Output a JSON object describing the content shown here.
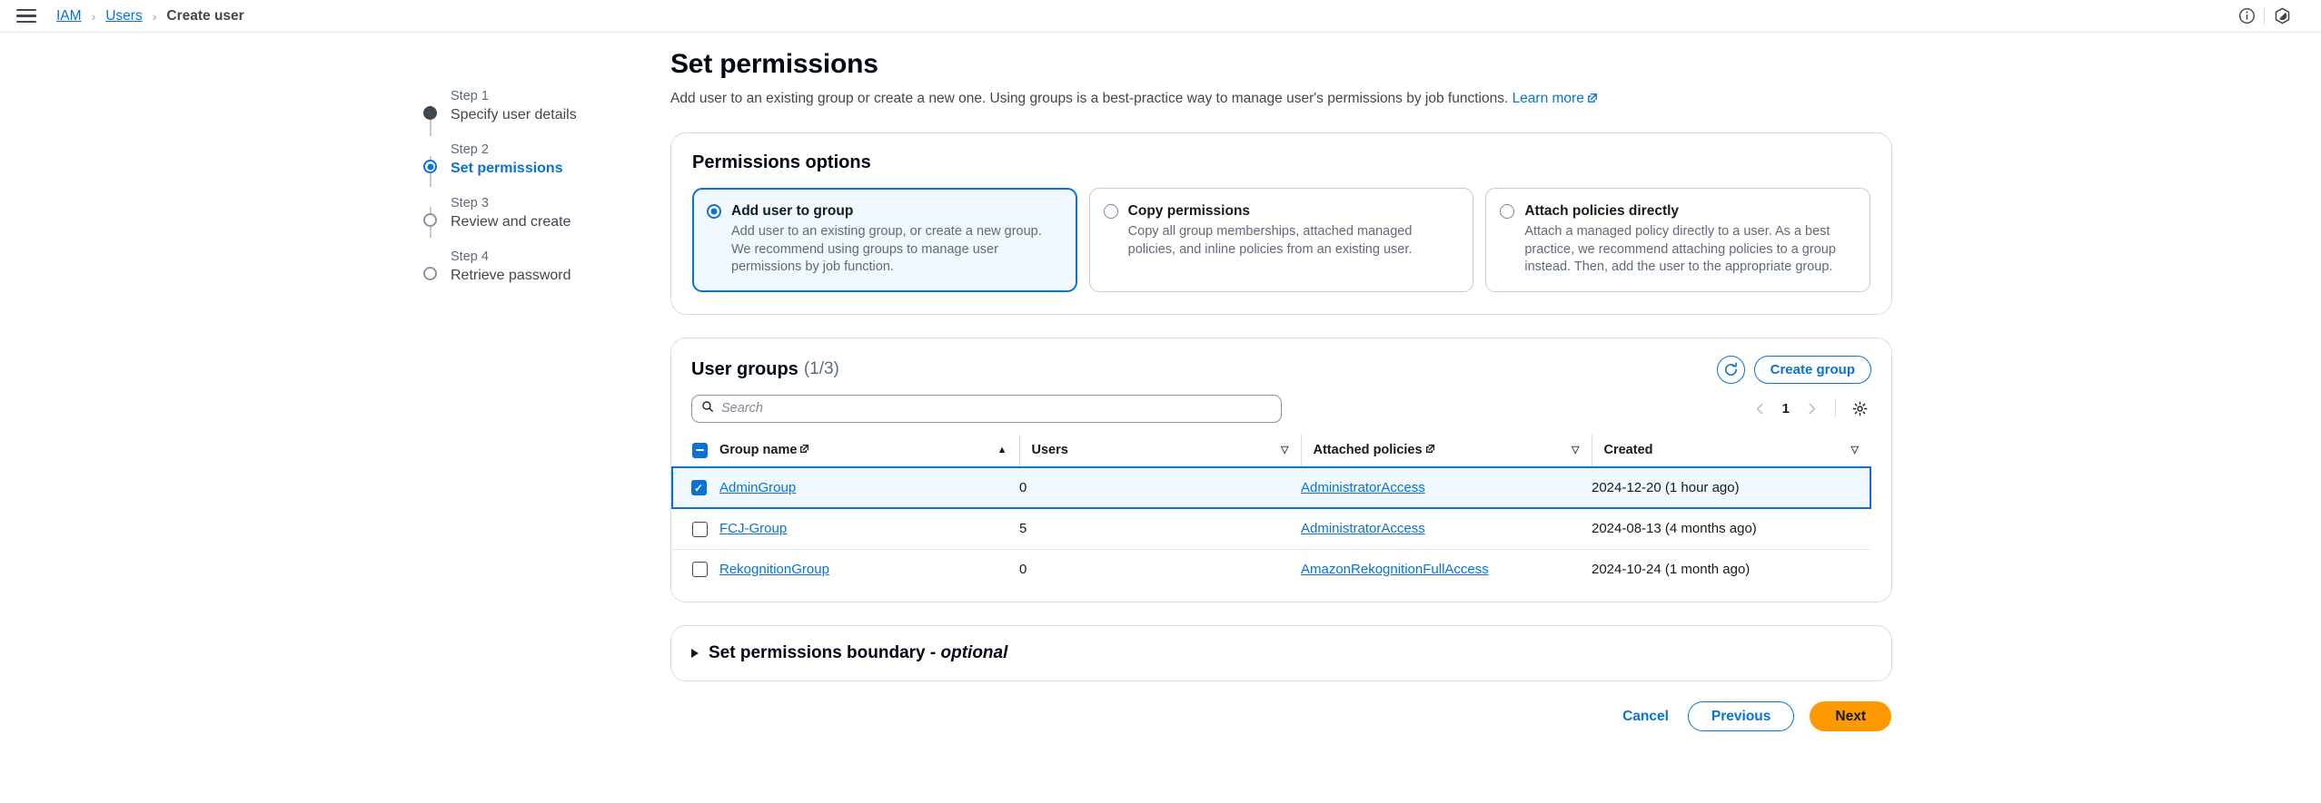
{
  "topbar": {
    "menu_icon": "hamburger-menu-icon",
    "breadcrumbs": [
      {
        "label": "IAM",
        "type": "link"
      },
      {
        "label": "Users",
        "type": "link"
      },
      {
        "label": "Create user",
        "type": "current"
      }
    ],
    "separator": "›",
    "info_icon": "info-circle-icon",
    "settings_icon": "settings-hexagon-icon"
  },
  "stepper": {
    "steps": [
      {
        "num": "Step 1",
        "label": "Specify user details",
        "state": "done"
      },
      {
        "num": "Step 2",
        "label": "Set permissions",
        "state": "current"
      },
      {
        "num": "Step 3",
        "label": "Review and create",
        "state": "pending"
      },
      {
        "num": "Step 4",
        "label": "Retrieve password",
        "state": "pending"
      }
    ]
  },
  "header": {
    "title": "Set permissions",
    "description": "Add user to an existing group or create a new one. Using groups is a best-practice way to manage user's permissions by job functions.",
    "learn_more": "Learn more",
    "external_icon": "external-link-icon"
  },
  "permissions_options": {
    "title": "Permissions options",
    "cards": [
      {
        "title": "Add user to group",
        "description": "Add user to an existing group, or create a new group. We recommend using groups to manage user permissions by job function.",
        "selected": true
      },
      {
        "title": "Copy permissions",
        "description": "Copy all group memberships, attached managed policies, and inline policies from an existing user.",
        "selected": false
      },
      {
        "title": "Attach policies directly",
        "description": "Attach a managed policy directly to a user. As a best practice, we recommend attaching policies to a group instead. Then, add the user to the appropriate group.",
        "selected": false
      }
    ]
  },
  "user_groups": {
    "title": "User groups",
    "count": "(1/3)",
    "refresh_icon": "refresh-icon",
    "create_group_label": "Create group",
    "search": {
      "placeholder": "Search",
      "value": "",
      "icon": "search-icon"
    },
    "pagination": {
      "prev_icon": "chevron-left-icon",
      "page": "1",
      "next_icon": "chevron-right-icon",
      "settings_icon": "gear-icon"
    },
    "columns": [
      {
        "label": "Group name",
        "external": true,
        "sort": "asc"
      },
      {
        "label": "Users",
        "external": false,
        "sort": "none"
      },
      {
        "label": "Attached policies",
        "external": true,
        "sort": "none"
      },
      {
        "label": "Created",
        "external": false,
        "sort": "none"
      }
    ],
    "header_checkbox_state": "indeterminate",
    "rows": [
      {
        "selected": true,
        "group_name": "AdminGroup",
        "users": "0",
        "attached_policies": "AdministratorAccess",
        "created": "2024-12-20 (1 hour ago)"
      },
      {
        "selected": false,
        "group_name": "FCJ-Group",
        "users": "5",
        "attached_policies": "AdministratorAccess",
        "created": "2024-08-13 (4 months ago)"
      },
      {
        "selected": false,
        "group_name": "RekognitionGroup",
        "users": "0",
        "attached_policies": "AmazonRekognitionFullAccess",
        "created": "2024-10-24 (1 month ago)"
      }
    ]
  },
  "boundary": {
    "label": "Set permissions boundary - ",
    "optional": "optional",
    "expanded": false,
    "icon": "triangle-right-icon"
  },
  "footer": {
    "cancel": "Cancel",
    "previous": "Previous",
    "next": "Next"
  },
  "colors": {
    "link_blue": "#0972d3",
    "accent_orange": "#ff9900",
    "selected_bg": "#f0f9ff",
    "border_gray": "#d8dce2",
    "text_dark": "#16191f",
    "text_muted": "#5f6b7a"
  }
}
